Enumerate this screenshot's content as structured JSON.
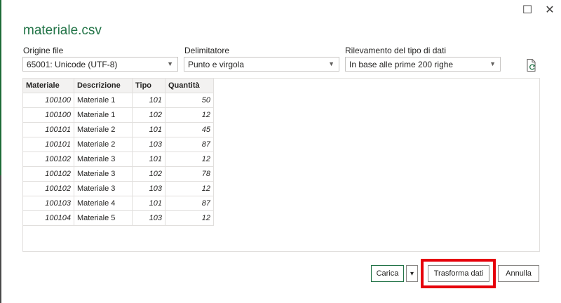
{
  "window": {
    "maximize_glyph": "☐",
    "close_glyph": "✕"
  },
  "dialog": {
    "title": "materiale.csv"
  },
  "options": {
    "file_origin": {
      "label": "Origine file",
      "value": "65001: Unicode (UTF-8)"
    },
    "delimiter": {
      "label": "Delimitatore",
      "value": "Punto e virgola"
    },
    "type_detection": {
      "label": "Rilevamento del tipo di dati",
      "value": "In base alle prime 200 righe"
    }
  },
  "table": {
    "headers": [
      "Materiale",
      "Descrizione",
      "Tipo",
      "Quantità"
    ],
    "rows": [
      [
        "100100",
        "Materiale 1",
        "101",
        "50"
      ],
      [
        "100100",
        "Materiale 1",
        "102",
        "12"
      ],
      [
        "100101",
        "Materiale 2",
        "101",
        "45"
      ],
      [
        "100101",
        "Materiale 2",
        "103",
        "87"
      ],
      [
        "100102",
        "Materiale 3",
        "101",
        "12"
      ],
      [
        "100102",
        "Materiale 3",
        "102",
        "78"
      ],
      [
        "100102",
        "Materiale 3",
        "103",
        "12"
      ],
      [
        "100103",
        "Materiale 4",
        "101",
        "87"
      ],
      [
        "100104",
        "Materiale 5",
        "103",
        "12"
      ]
    ]
  },
  "buttons": {
    "load": "Carica",
    "load_menu": "▾",
    "transform": "Trasforma dati",
    "cancel": "Annulla"
  },
  "colors": {
    "accent": "#217346",
    "highlight": "#e6000b"
  }
}
